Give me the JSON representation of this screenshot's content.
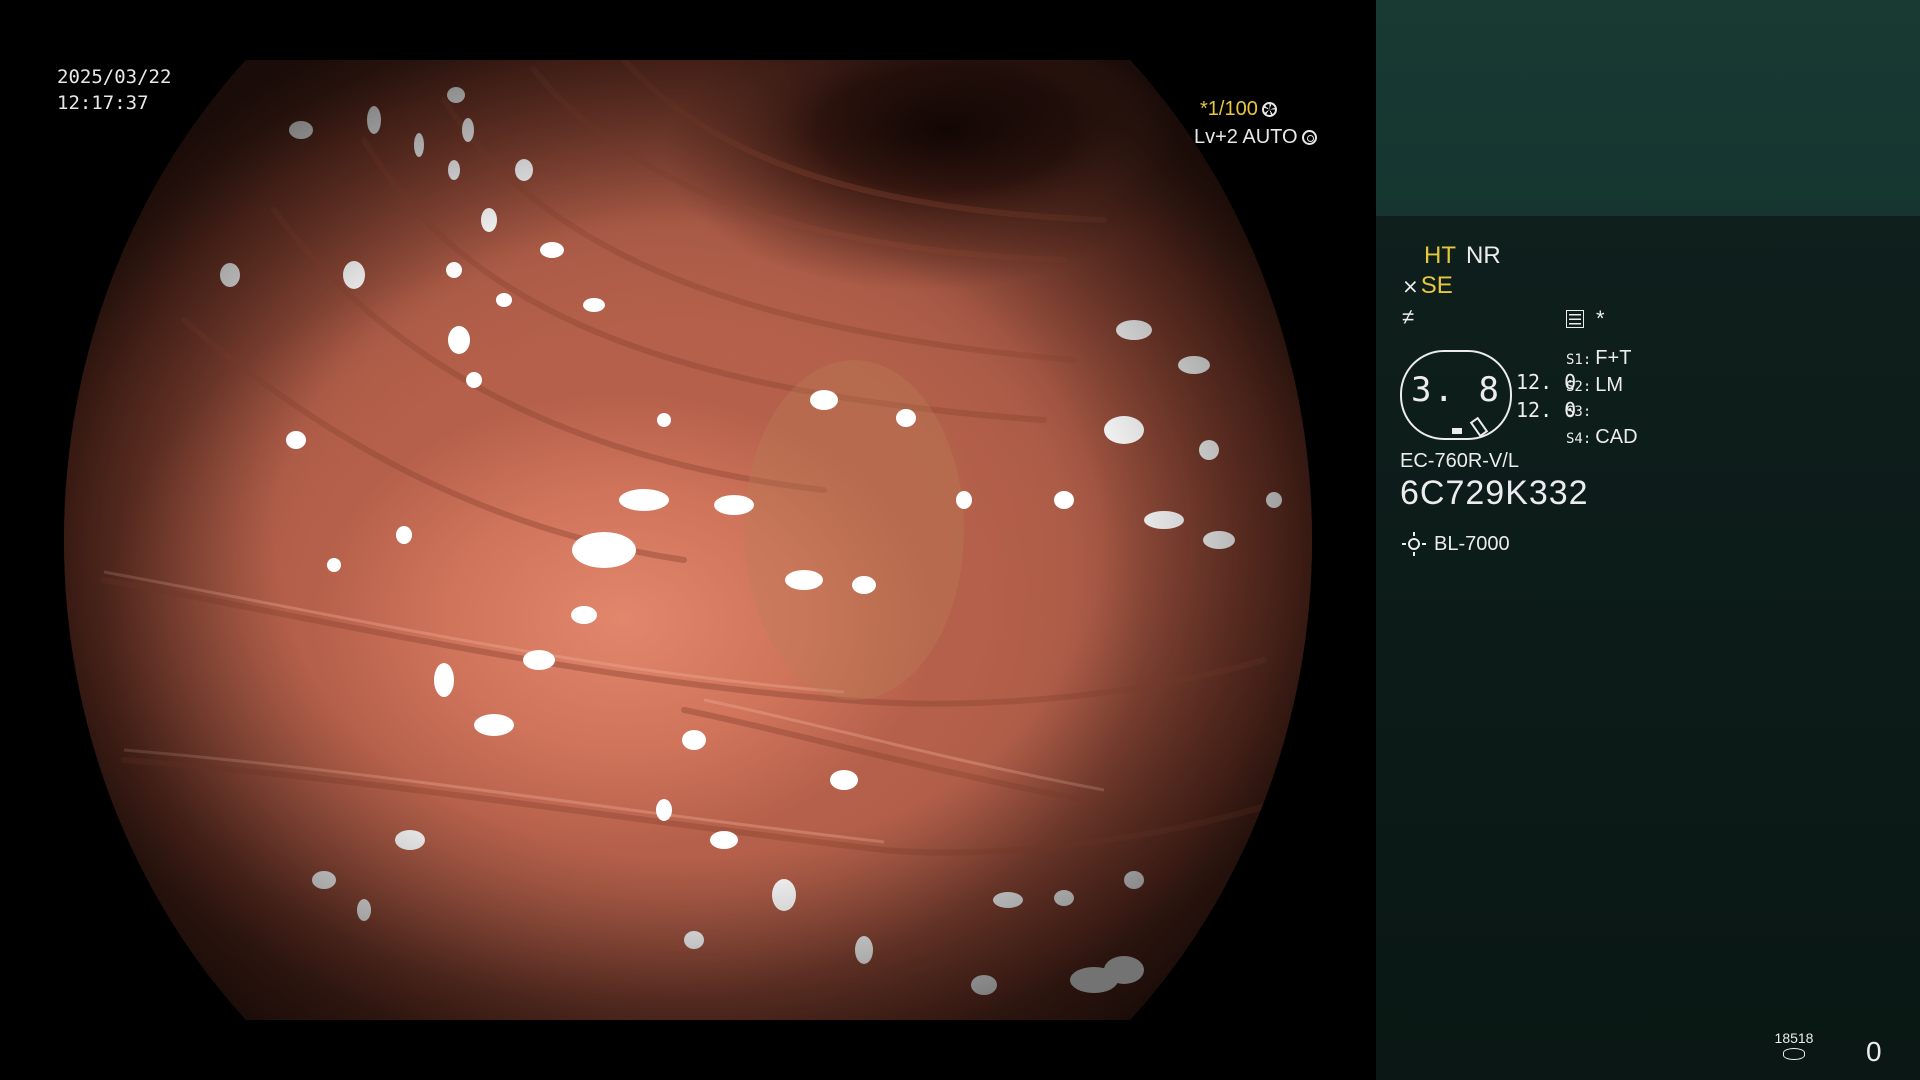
{
  "overlay": {
    "date": "2025/03/22",
    "time": "12:17:37",
    "shutter": "*1/100",
    "level": "Lv+2 AUTO"
  },
  "panel": {
    "ht_label": "HT",
    "nr_label": "NR",
    "se_label": "SE",
    "sharp_symbol": "≠",
    "mem_symbol": "*",
    "gauge_value": "3. 8",
    "zoom_values": [
      "12. 0",
      "12. 0"
    ],
    "switches": [
      {
        "key": "S1:",
        "value": "F+T"
      },
      {
        "key": "S2:",
        "value": "LM"
      },
      {
        "key": "S3:",
        "value": ""
      },
      {
        "key": "S4:",
        "value": "CAD"
      }
    ],
    "model": "EC-760R-V/L",
    "serial": "6C729K332",
    "light_source": "BL-7000",
    "image_counter": "18518",
    "remaining": "0"
  },
  "colors": {
    "accent_yellow": "#e7c640",
    "panel_dark": "#0b1a17",
    "panel_header": "#183a33",
    "text_white": "#ececec"
  },
  "icons": [
    "aperture-icon",
    "ring-icon",
    "fiber-icon",
    "sharpness-icon",
    "memo-icon",
    "tilt-icon",
    "sun-icon",
    "disk-icon"
  ]
}
